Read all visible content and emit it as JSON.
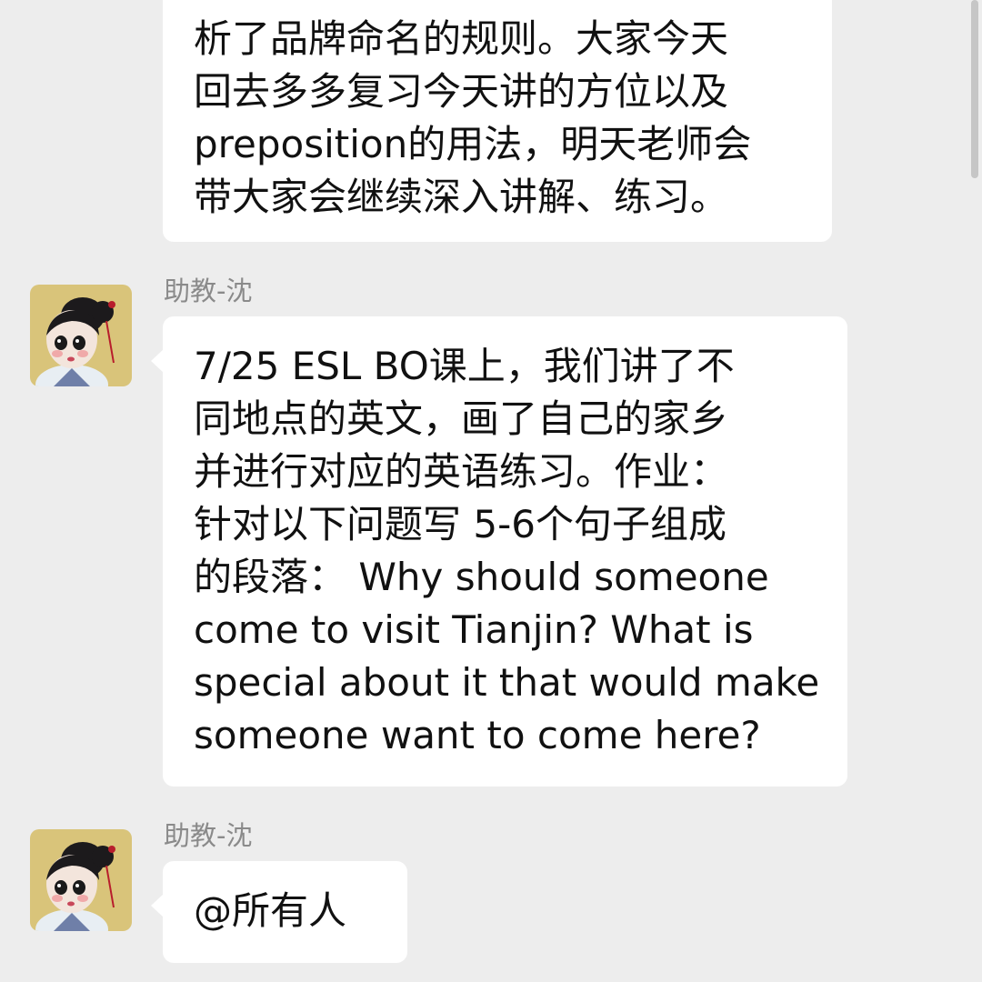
{
  "messages": [
    {
      "sender": "",
      "lines": [
        "析了品牌命名的规则。大家今天",
        "回去多多复习今天讲的方位以及",
        "preposition的用法，明天老师会",
        "带大家会继续深入讲解、练习。"
      ]
    },
    {
      "sender": "助教-沈",
      "lines": [
        "7/25 ESL BO课上，我们讲了不",
        "同地点的英文，画了自己的家乡",
        "并进行对应的英语练习。作业：",
        "针对以下问题写 5-6个句子组成",
        "的段落： Why should someone",
        "come to visit Tianjin? What is",
        "special about it that would make",
        "someone want to come here?"
      ]
    },
    {
      "sender": "助教-沈",
      "lines": [
        "@所有人"
      ]
    }
  ],
  "colors": {
    "background": "#ededed",
    "bubble": "#ffffff",
    "sender_text": "#8a8a8a",
    "message_text": "#111111",
    "scrollbar": "#c6c6c6"
  },
  "icons": {
    "avatar": "cartoon-girl-avatar"
  }
}
